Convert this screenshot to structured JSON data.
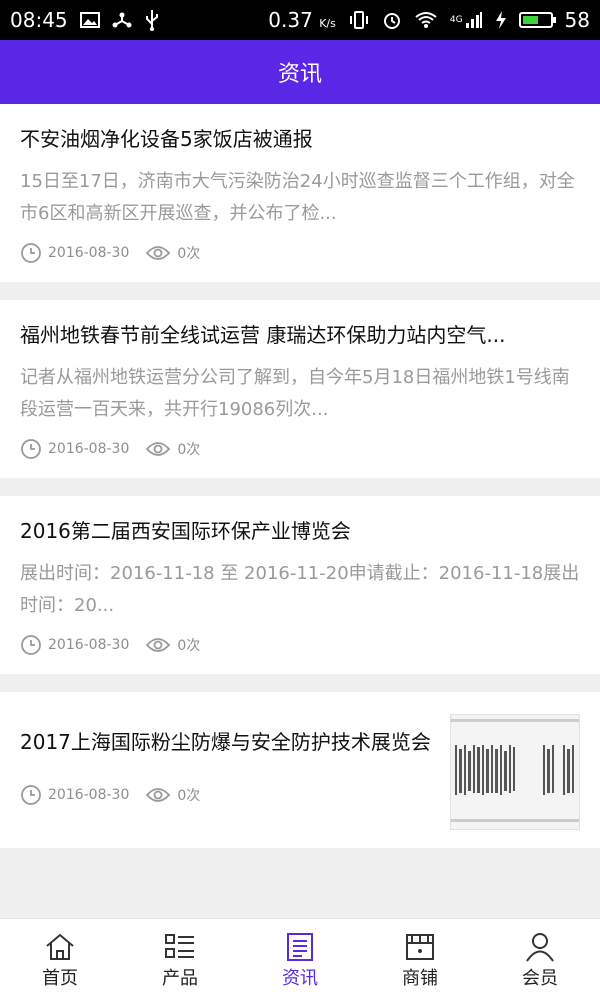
{
  "statusbar": {
    "time": "08:45",
    "speed": "0.37",
    "speed_unit": "K/s",
    "network": "4G",
    "battery_level": "58",
    "battery_fraction": 0.58
  },
  "header": {
    "title": "资讯"
  },
  "news": [
    {
      "title": "不安油烟净化设备5家饭店被通报",
      "summary": "15日至17日，济南市大气污染防治24小时巡查监督三个工作组，对全市6区和高新区开展巡查，并公布了检...",
      "date": "2016-08-30",
      "views": "0次"
    },
    {
      "title": "福州地铁春节前全线试运营 康瑞达环保助力站内空气...",
      "summary": "记者从福州地铁运营分公司了解到，自今年5月18日福州地铁1号线南段运营一百天来，共开行19086列次...",
      "date": "2016-08-30",
      "views": "0次"
    },
    {
      "title": "2016第二届西安国际环保产业博览会",
      "summary": "展出时间：2016-11-18 至 2016-11-20申请截止：2016-11-18展出时间：20...",
      "date": "2016-08-30",
      "views": "0次"
    },
    {
      "title": "2017上海国际粉尘防爆与安全防护技术展览会",
      "date": "2016-08-30",
      "views": "0次"
    }
  ],
  "tabbar": [
    {
      "label": "首页",
      "icon": "home-icon"
    },
    {
      "label": "产品",
      "icon": "list-icon"
    },
    {
      "label": "资讯",
      "icon": "news-icon",
      "active": true
    },
    {
      "label": "商铺",
      "icon": "shop-icon"
    },
    {
      "label": "会员",
      "icon": "user-icon"
    }
  ],
  "colors": {
    "accent": "#5b27e6",
    "muted": "#9a9a9a",
    "divider": "#f0f0f0"
  }
}
